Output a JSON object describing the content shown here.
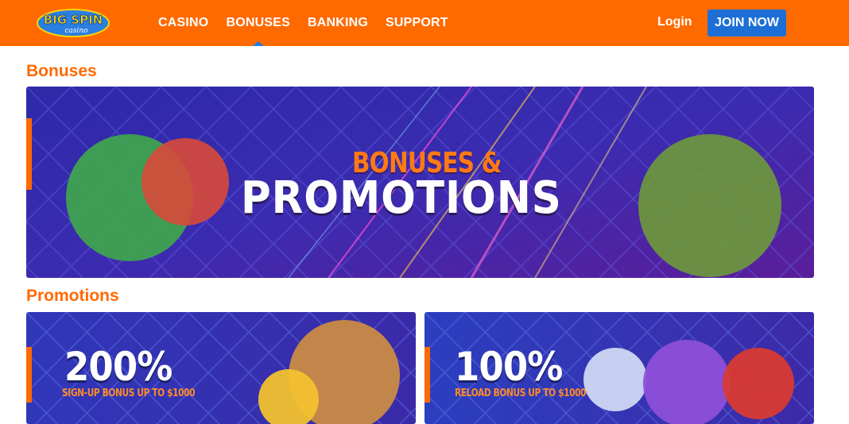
{
  "header": {
    "logo_text": "BIG SPIN",
    "logo_subtext": "casino",
    "nav": [
      {
        "label": "CASINO"
      },
      {
        "label": "BONUSES"
      },
      {
        "label": "BANKING"
      },
      {
        "label": "SUPPORT"
      }
    ],
    "login_label": "Login",
    "join_label": "JOIN NOW"
  },
  "colors": {
    "brand_orange": "#ff6a00",
    "join_blue": "#1d6fd6",
    "banner_purple": "#3a2aa8"
  },
  "sections": {
    "bonuses_title": "Bonuses",
    "promotions_title": "Promotions"
  },
  "hero_banner": {
    "line1": "BONUSES &",
    "line2": "PROMOTIONS"
  },
  "promos": [
    {
      "headline": "200%",
      "subline": "SIGN-UP BONUS UP TO $1000"
    },
    {
      "headline": "100%",
      "subline": "RELOAD BONUS UP TO $1000"
    }
  ]
}
